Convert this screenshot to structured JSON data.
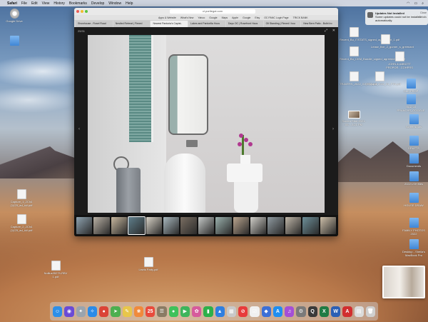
{
  "menubar": {
    "app_name": "Safari",
    "items": [
      "File",
      "Edit",
      "View",
      "History",
      "Bookmarks",
      "Develop",
      "Window",
      "Help"
    ]
  },
  "browser": {
    "url": "cl.portlegal.com",
    "bookmarks": [
      "Apps & Website",
      "What's New",
      "Yahoo",
      "Google",
      "Maps",
      "Apple",
      "Google",
      "Etsy",
      "OC PANC Login Page",
      "TRICK BANK"
    ],
    "tabs": [
      {
        "label": "Showhouse - Rosel Road",
        "active": false
      },
      {
        "label": "Nestled Retreat | Flexed",
        "active": false
      },
      {
        "label": "Newest Pantoria's Capist..",
        "active": true
      },
      {
        "label": "Lakes and Pantorilla Hous",
        "active": false
      },
      {
        "label": "Days OC | Rosefront Hous",
        "active": false
      },
      {
        "label": "Oil Standing | Flexed I hou",
        "active": false
      },
      {
        "label": "New Bern Patio - Bulbi Iro",
        "active": false
      }
    ],
    "photo_counter": "25/31"
  },
  "notification": {
    "title": "Updates Not Installed",
    "body": "Some updates could not be installed automatically.",
    "close_label": "Close",
    "details_label": "Details"
  },
  "desktop_icons": [
    {
      "name": "drive-icon",
      "label": "Google Drive",
      "kind": "drive"
    },
    {
      "name": "folder-icon",
      "label": "",
      "kind": "folder"
    },
    {
      "name": "doc-icon-1",
      "label": "Capture_1_2Ch4 (1)CB_ad_kkl.pdf",
      "kind": "doc"
    },
    {
      "name": "doc-icon-2",
      "label": "Capture_2_2Ch4 (1)CB_ad_kkl.pdf",
      "kind": "doc"
    },
    {
      "name": "doc-icon-3",
      "label": "Nullius35275-RBV 1.pdf",
      "kind": "doc"
    },
    {
      "name": "doc-icon-4",
      "label": "Lewis Party.pdf",
      "kind": "doc"
    },
    {
      "name": "doc-icon-5",
      "label": "Recent_Bo_ITSTATS_signed_agreement_1.pdf",
      "kind": "doc"
    },
    {
      "name": "doc-icon-6",
      "label": "Recent_Bo_CKM_Bundle_signed_agreement_2.pdf",
      "kind": "doc"
    },
    {
      "name": "doc-icon-7",
      "label": "Lease_fixe_2_gurner_s_greenant",
      "kind": "doc"
    },
    {
      "name": "doc-icon-8",
      "label": "JOHN & ABBOTT PROPOR...COHPRS",
      "kind": "doc"
    },
    {
      "name": "folder-icon-2",
      "label": "OLD PROP",
      "kind": "folder"
    },
    {
      "name": "doc-icon-9",
      "label": "TRAVERS_2022_01_FTA.pdf",
      "kind": "doc"
    },
    {
      "name": "doc-icon-10",
      "label": "Shipyard_2022_01_FTA.pdf",
      "kind": "doc"
    },
    {
      "name": "folder-icon-3",
      "label": "BAD ull PRANCHS_GOOGLE",
      "kind": "folder"
    },
    {
      "name": "folder-icon-4",
      "label": "Screenshots",
      "kind": "folder"
    },
    {
      "name": "folder-icon-5",
      "label": "DRAFTS",
      "kind": "folder"
    },
    {
      "name": "folder-icon-6",
      "label": "Documents",
      "kind": "folder"
    },
    {
      "name": "folder-icon-7",
      "label": "2022 LSH files",
      "kind": "folder"
    },
    {
      "name": "folder-icon-8",
      "label": "HOUSE DRAW",
      "kind": "folder"
    },
    {
      "name": "folder-icon-9",
      "label": "FAMILY PHOTOS 2022",
      "kind": "folder"
    },
    {
      "name": "folder-icon-10",
      "label": "Desktop - Sheila's MacBook Pro",
      "kind": "folder"
    },
    {
      "name": "shot-icon",
      "label": "Screen Shot 2021-05-...3:21 PM",
      "kind": "shot"
    }
  ],
  "dock_apps": [
    {
      "name": "finder-icon",
      "glyph": "☺",
      "color": "#2e8fe8"
    },
    {
      "name": "siri-icon",
      "glyph": "◉",
      "color": "#6a4bd6"
    },
    {
      "name": "launchpad-icon",
      "glyph": "✦",
      "color": "#9aa4ae"
    },
    {
      "name": "safari-icon",
      "glyph": "✧",
      "color": "#2a8be8"
    },
    {
      "name": "chrome-icon",
      "glyph": "●",
      "color": "#db4437"
    },
    {
      "name": "maps-icon",
      "glyph": "➤",
      "color": "#4caf50"
    },
    {
      "name": "notes-icon",
      "glyph": "✎",
      "color": "#e8c64a"
    },
    {
      "name": "photos-icon",
      "glyph": "❀",
      "color": "#f08a3c"
    },
    {
      "name": "calendar-icon",
      "glyph": "25",
      "color": "#e84b3c"
    },
    {
      "name": "contacts-icon",
      "glyph": "☰",
      "color": "#8a7b64"
    },
    {
      "name": "messages-icon",
      "glyph": "●",
      "color": "#3ec15a"
    },
    {
      "name": "facetime-icon",
      "glyph": "▶",
      "color": "#3cb55c"
    },
    {
      "name": "photos2-icon",
      "glyph": "✿",
      "color": "#d65b9c"
    },
    {
      "name": "numbers-icon",
      "glyph": "▮",
      "color": "#2db04a"
    },
    {
      "name": "keynote-icon",
      "glyph": "▲",
      "color": "#2f7fe0"
    },
    {
      "name": "preview-icon",
      "glyph": "▦",
      "color": "#c9c9c9"
    },
    {
      "name": "news-icon",
      "glyph": "⊘",
      "color": "#e83b3b"
    },
    {
      "name": "reminders-icon",
      "glyph": "☑",
      "color": "#f0f0f0"
    },
    {
      "name": "keynote2-icon",
      "glyph": "◆",
      "color": "#3b6fd6"
    },
    {
      "name": "appstore-icon",
      "glyph": "A",
      "color": "#1f8ef0"
    },
    {
      "name": "podcasts-icon",
      "glyph": "♫",
      "color": "#a44fd6"
    },
    {
      "name": "systemprefs-icon",
      "glyph": "⚙",
      "color": "#7a7a7a"
    },
    {
      "name": "quicktime-icon",
      "glyph": "Q",
      "color": "#3a3a3a"
    },
    {
      "name": "excel-icon",
      "glyph": "X",
      "color": "#1f7b44"
    },
    {
      "name": "word-icon",
      "glyph": "W",
      "color": "#2b5fb5"
    },
    {
      "name": "acrobat-icon",
      "glyph": "A",
      "color": "#d12f2f"
    },
    {
      "name": "downloads-icon",
      "glyph": "▤",
      "color": "#dbdbdb"
    },
    {
      "name": "trash-icon",
      "glyph": "🗑",
      "color": "#cfcfcf"
    }
  ]
}
